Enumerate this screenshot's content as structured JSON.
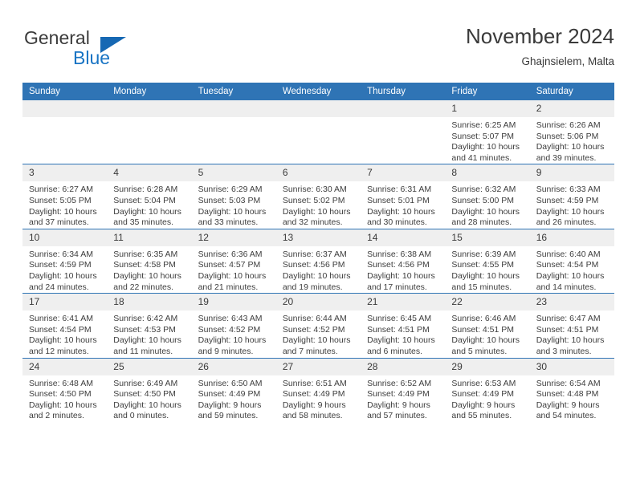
{
  "brand": {
    "name_part1": "General",
    "name_part2": "Blue",
    "flag_icon": "blue-triangle-flag-icon",
    "accent_color": "#1874c4"
  },
  "header": {
    "title": "November 2024",
    "subtitle": "Ghajnsielem, Malta"
  },
  "theme": {
    "header_blue": "#2f74b5",
    "daynum_band": "#efefef",
    "text": "#3d3d3d"
  },
  "calendar": {
    "weekday_headers": [
      "Sunday",
      "Monday",
      "Tuesday",
      "Wednesday",
      "Thursday",
      "Friday",
      "Saturday"
    ],
    "weeks": [
      [
        {
          "day": "",
          "empty": true
        },
        {
          "day": "",
          "empty": true
        },
        {
          "day": "",
          "empty": true
        },
        {
          "day": "",
          "empty": true
        },
        {
          "day": "",
          "empty": true
        },
        {
          "day": "1",
          "sunrise": "Sunrise: 6:25 AM",
          "sunset": "Sunset: 5:07 PM",
          "daylight": "Daylight: 10 hours and 41 minutes."
        },
        {
          "day": "2",
          "sunrise": "Sunrise: 6:26 AM",
          "sunset": "Sunset: 5:06 PM",
          "daylight": "Daylight: 10 hours and 39 minutes."
        }
      ],
      [
        {
          "day": "3",
          "sunrise": "Sunrise: 6:27 AM",
          "sunset": "Sunset: 5:05 PM",
          "daylight": "Daylight: 10 hours and 37 minutes."
        },
        {
          "day": "4",
          "sunrise": "Sunrise: 6:28 AM",
          "sunset": "Sunset: 5:04 PM",
          "daylight": "Daylight: 10 hours and 35 minutes."
        },
        {
          "day": "5",
          "sunrise": "Sunrise: 6:29 AM",
          "sunset": "Sunset: 5:03 PM",
          "daylight": "Daylight: 10 hours and 33 minutes."
        },
        {
          "day": "6",
          "sunrise": "Sunrise: 6:30 AM",
          "sunset": "Sunset: 5:02 PM",
          "daylight": "Daylight: 10 hours and 32 minutes."
        },
        {
          "day": "7",
          "sunrise": "Sunrise: 6:31 AM",
          "sunset": "Sunset: 5:01 PM",
          "daylight": "Daylight: 10 hours and 30 minutes."
        },
        {
          "day": "8",
          "sunrise": "Sunrise: 6:32 AM",
          "sunset": "Sunset: 5:00 PM",
          "daylight": "Daylight: 10 hours and 28 minutes."
        },
        {
          "day": "9",
          "sunrise": "Sunrise: 6:33 AM",
          "sunset": "Sunset: 4:59 PM",
          "daylight": "Daylight: 10 hours and 26 minutes."
        }
      ],
      [
        {
          "day": "10",
          "sunrise": "Sunrise: 6:34 AM",
          "sunset": "Sunset: 4:59 PM",
          "daylight": "Daylight: 10 hours and 24 minutes."
        },
        {
          "day": "11",
          "sunrise": "Sunrise: 6:35 AM",
          "sunset": "Sunset: 4:58 PM",
          "daylight": "Daylight: 10 hours and 22 minutes."
        },
        {
          "day": "12",
          "sunrise": "Sunrise: 6:36 AM",
          "sunset": "Sunset: 4:57 PM",
          "daylight": "Daylight: 10 hours and 21 minutes."
        },
        {
          "day": "13",
          "sunrise": "Sunrise: 6:37 AM",
          "sunset": "Sunset: 4:56 PM",
          "daylight": "Daylight: 10 hours and 19 minutes."
        },
        {
          "day": "14",
          "sunrise": "Sunrise: 6:38 AM",
          "sunset": "Sunset: 4:56 PM",
          "daylight": "Daylight: 10 hours and 17 minutes."
        },
        {
          "day": "15",
          "sunrise": "Sunrise: 6:39 AM",
          "sunset": "Sunset: 4:55 PM",
          "daylight": "Daylight: 10 hours and 15 minutes."
        },
        {
          "day": "16",
          "sunrise": "Sunrise: 6:40 AM",
          "sunset": "Sunset: 4:54 PM",
          "daylight": "Daylight: 10 hours and 14 minutes."
        }
      ],
      [
        {
          "day": "17",
          "sunrise": "Sunrise: 6:41 AM",
          "sunset": "Sunset: 4:54 PM",
          "daylight": "Daylight: 10 hours and 12 minutes."
        },
        {
          "day": "18",
          "sunrise": "Sunrise: 6:42 AM",
          "sunset": "Sunset: 4:53 PM",
          "daylight": "Daylight: 10 hours and 11 minutes."
        },
        {
          "day": "19",
          "sunrise": "Sunrise: 6:43 AM",
          "sunset": "Sunset: 4:52 PM",
          "daylight": "Daylight: 10 hours and 9 minutes."
        },
        {
          "day": "20",
          "sunrise": "Sunrise: 6:44 AM",
          "sunset": "Sunset: 4:52 PM",
          "daylight": "Daylight: 10 hours and 7 minutes."
        },
        {
          "day": "21",
          "sunrise": "Sunrise: 6:45 AM",
          "sunset": "Sunset: 4:51 PM",
          "daylight": "Daylight: 10 hours and 6 minutes."
        },
        {
          "day": "22",
          "sunrise": "Sunrise: 6:46 AM",
          "sunset": "Sunset: 4:51 PM",
          "daylight": "Daylight: 10 hours and 5 minutes."
        },
        {
          "day": "23",
          "sunrise": "Sunrise: 6:47 AM",
          "sunset": "Sunset: 4:51 PM",
          "daylight": "Daylight: 10 hours and 3 minutes."
        }
      ],
      [
        {
          "day": "24",
          "sunrise": "Sunrise: 6:48 AM",
          "sunset": "Sunset: 4:50 PM",
          "daylight": "Daylight: 10 hours and 2 minutes."
        },
        {
          "day": "25",
          "sunrise": "Sunrise: 6:49 AM",
          "sunset": "Sunset: 4:50 PM",
          "daylight": "Daylight: 10 hours and 0 minutes."
        },
        {
          "day": "26",
          "sunrise": "Sunrise: 6:50 AM",
          "sunset": "Sunset: 4:49 PM",
          "daylight": "Daylight: 9 hours and 59 minutes."
        },
        {
          "day": "27",
          "sunrise": "Sunrise: 6:51 AM",
          "sunset": "Sunset: 4:49 PM",
          "daylight": "Daylight: 9 hours and 58 minutes."
        },
        {
          "day": "28",
          "sunrise": "Sunrise: 6:52 AM",
          "sunset": "Sunset: 4:49 PM",
          "daylight": "Daylight: 9 hours and 57 minutes."
        },
        {
          "day": "29",
          "sunrise": "Sunrise: 6:53 AM",
          "sunset": "Sunset: 4:49 PM",
          "daylight": "Daylight: 9 hours and 55 minutes."
        },
        {
          "day": "30",
          "sunrise": "Sunrise: 6:54 AM",
          "sunset": "Sunset: 4:48 PM",
          "daylight": "Daylight: 9 hours and 54 minutes."
        }
      ]
    ]
  }
}
